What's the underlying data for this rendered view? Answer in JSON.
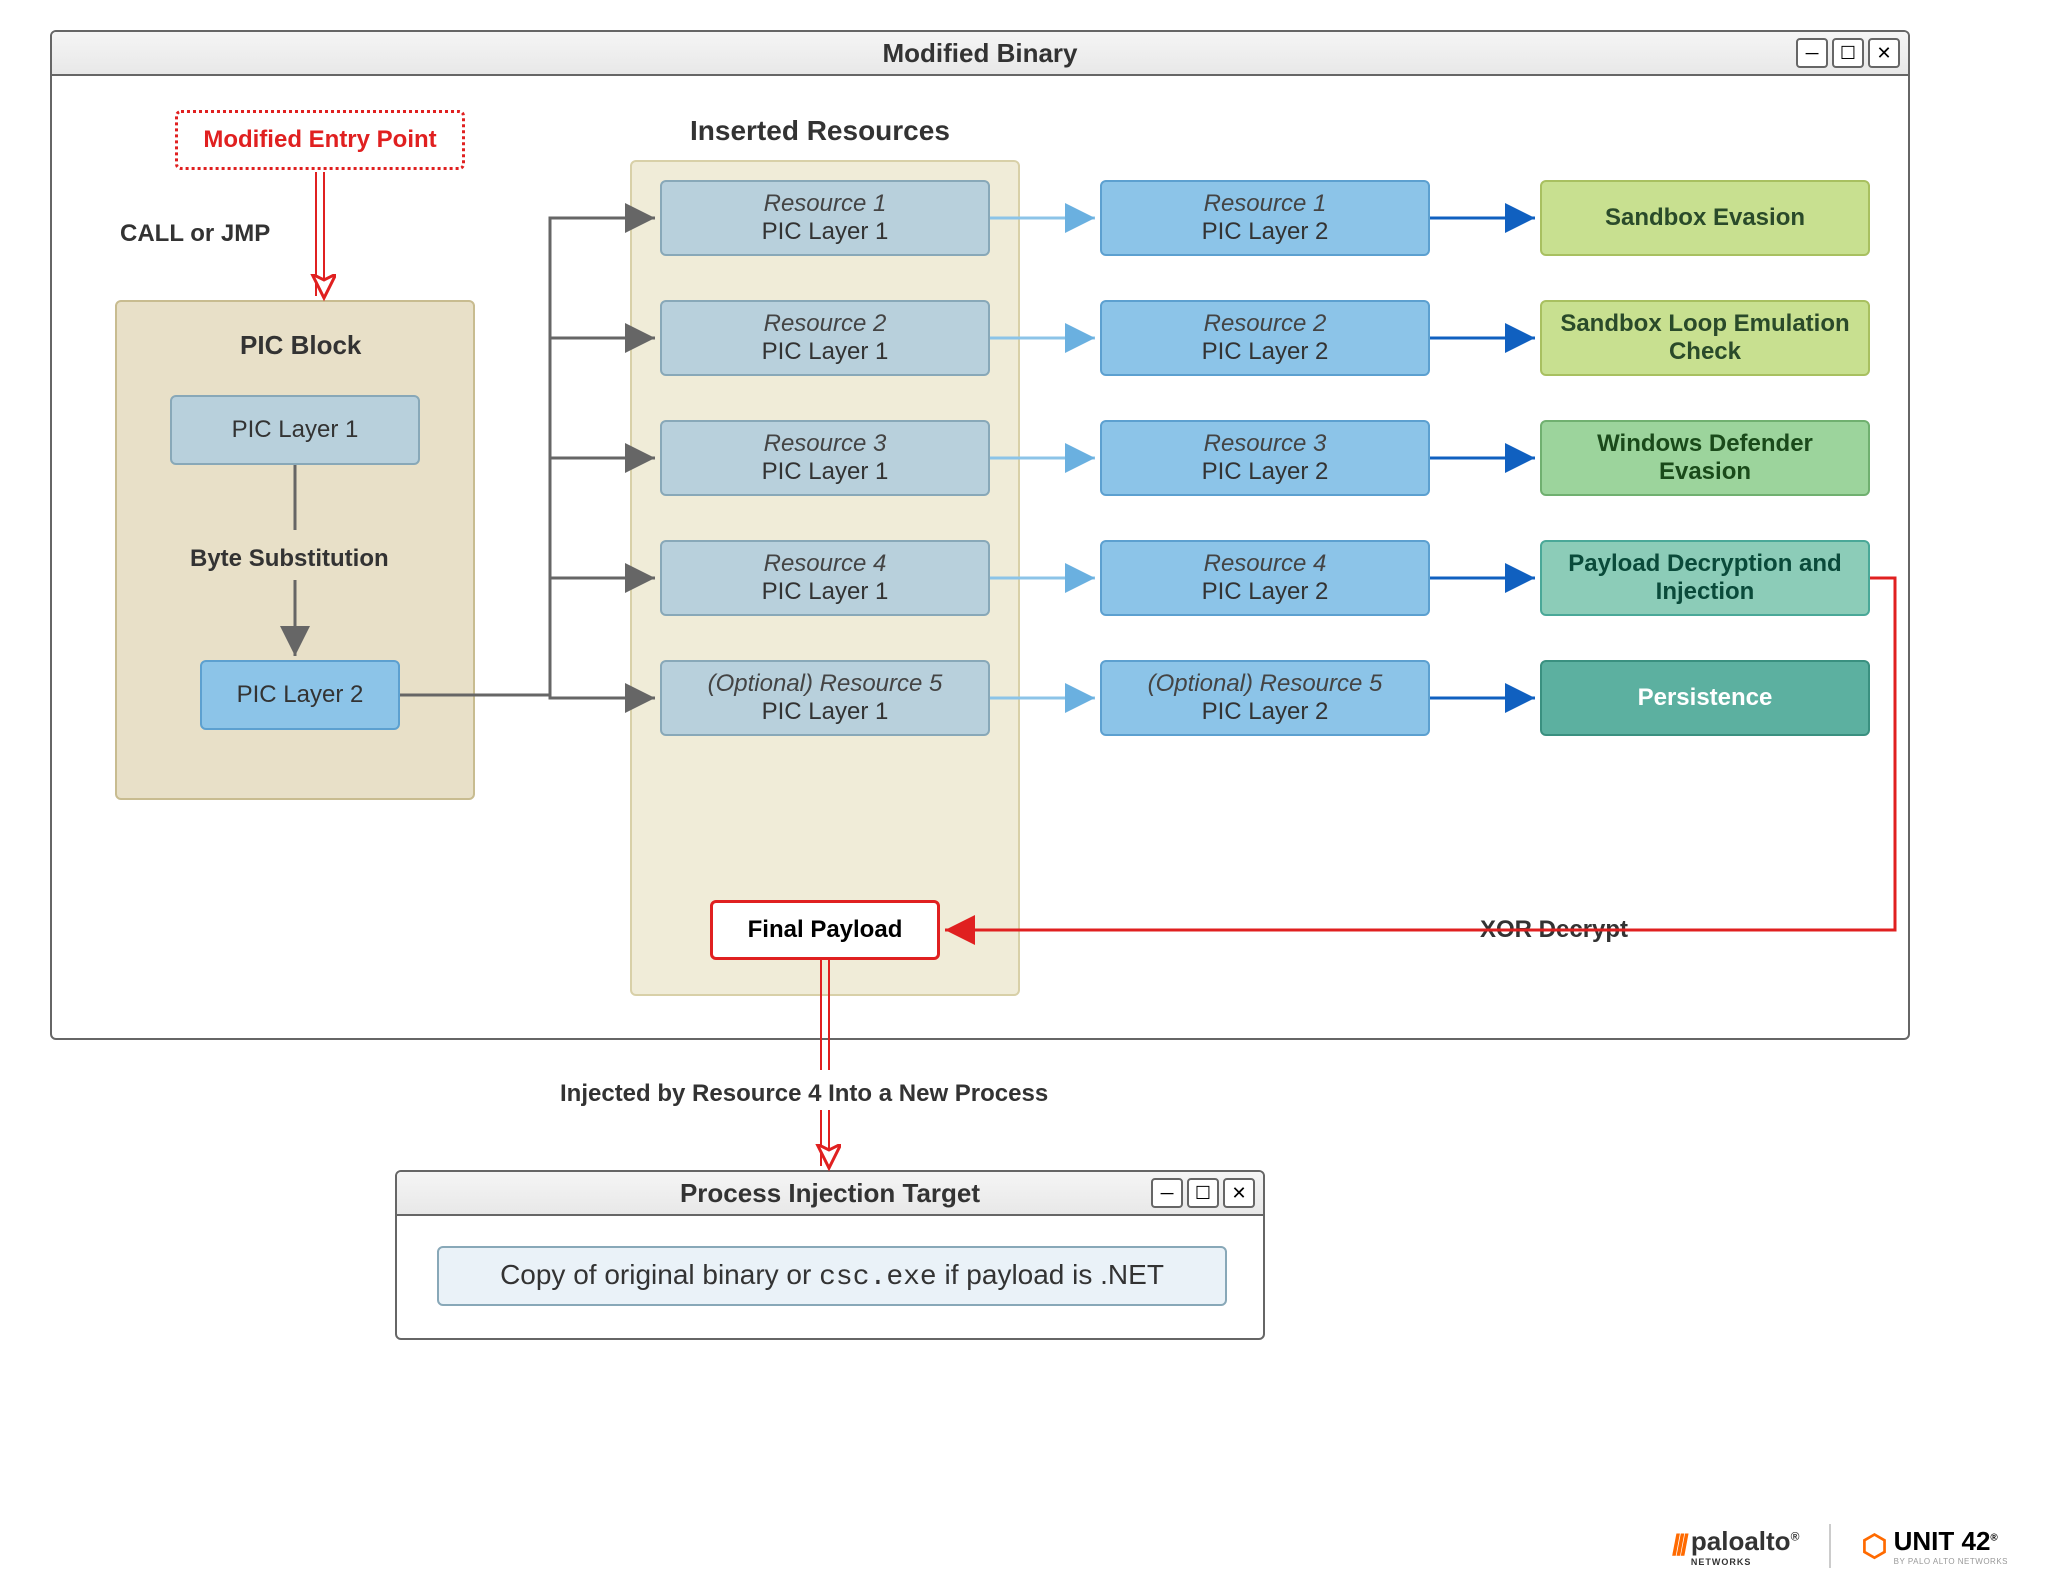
{
  "main_window": {
    "title": "Modified Binary"
  },
  "entry_point": "Modified Entry Point",
  "call_jmp": "CALL or JMP",
  "pic_block": {
    "title": "PIC Block",
    "layer1": "PIC Layer 1",
    "layer2": "PIC Layer 2",
    "byte_sub": "Byte Substitution"
  },
  "inserted_title": "Inserted Resources",
  "resources": [
    {
      "name": "Resource 1",
      "l1": "PIC Layer 1",
      "l2": "PIC Layer 2",
      "outcome": "Sandbox Evasion",
      "outcome_class": "box-green-light"
    },
    {
      "name": "Resource 2",
      "l1": "PIC Layer 1",
      "l2": "PIC Layer 2",
      "outcome": "Sandbox Loop Emulation Check",
      "outcome_class": "box-green-light"
    },
    {
      "name": "Resource 3",
      "l1": "PIC Layer 1",
      "l2": "PIC Layer 2",
      "outcome": "Windows Defender Evasion",
      "outcome_class": "box-green-med"
    },
    {
      "name": "Resource 4",
      "l1": "PIC Layer 1",
      "l2": "PIC Layer 2",
      "outcome": "Payload Decryption and Injection",
      "outcome_class": "box-green-dark"
    },
    {
      "name": "(Optional) Resource 5",
      "l1": "PIC Layer 1",
      "l2": "PIC Layer 2",
      "outcome": "Persistence",
      "outcome_class": "box-teal"
    }
  ],
  "final_payload": "Final Payload",
  "xor_decrypt": "XOR Decrypt",
  "injected_label": "Injected by Resource 4 Into a New Process",
  "target_window": {
    "title": "Process Injection Target"
  },
  "target_text_pre": "Copy of original binary or ",
  "target_text_mono": "csc.exe",
  "target_text_post": " if payload is .NET",
  "logos": {
    "paloalto": "paloalto",
    "paloalto_sub": "NETWORKS",
    "unit42": "UNIT 42",
    "unit42_sub": "BY PALO ALTO NETWORKS"
  }
}
